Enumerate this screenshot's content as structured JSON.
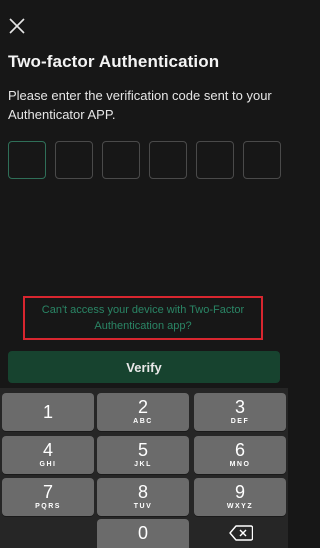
{
  "header": {
    "close_icon": "close-icon",
    "title": "Two-factor Authentication",
    "instruction": "Please enter the verification code sent to your Authenticator APP."
  },
  "code_input": {
    "digits": [
      "",
      "",
      "",
      "",
      "",
      ""
    ],
    "active_index": 0
  },
  "help_link": {
    "text": "Can't access your device with Two-Factor Authentication app?"
  },
  "verify_button": {
    "label": "Verify"
  },
  "colors": {
    "background": "#171717",
    "accent": "#2a8565",
    "verify_button": "#17432f",
    "highlight_border": "#d8262f",
    "key": "#6b6b6b"
  },
  "keypad": {
    "keys": [
      {
        "digit": "1",
        "letters": ""
      },
      {
        "digit": "2",
        "letters": "ABC"
      },
      {
        "digit": "3",
        "letters": "DEF"
      },
      {
        "digit": "4",
        "letters": "GHI"
      },
      {
        "digit": "5",
        "letters": "JKL"
      },
      {
        "digit": "6",
        "letters": "MNO"
      },
      {
        "digit": "7",
        "letters": "PQRS"
      },
      {
        "digit": "8",
        "letters": "TUV"
      },
      {
        "digit": "9",
        "letters": "WXYZ"
      },
      {
        "digit": "0",
        "letters": ""
      }
    ],
    "backspace_icon": "backspace-icon"
  }
}
